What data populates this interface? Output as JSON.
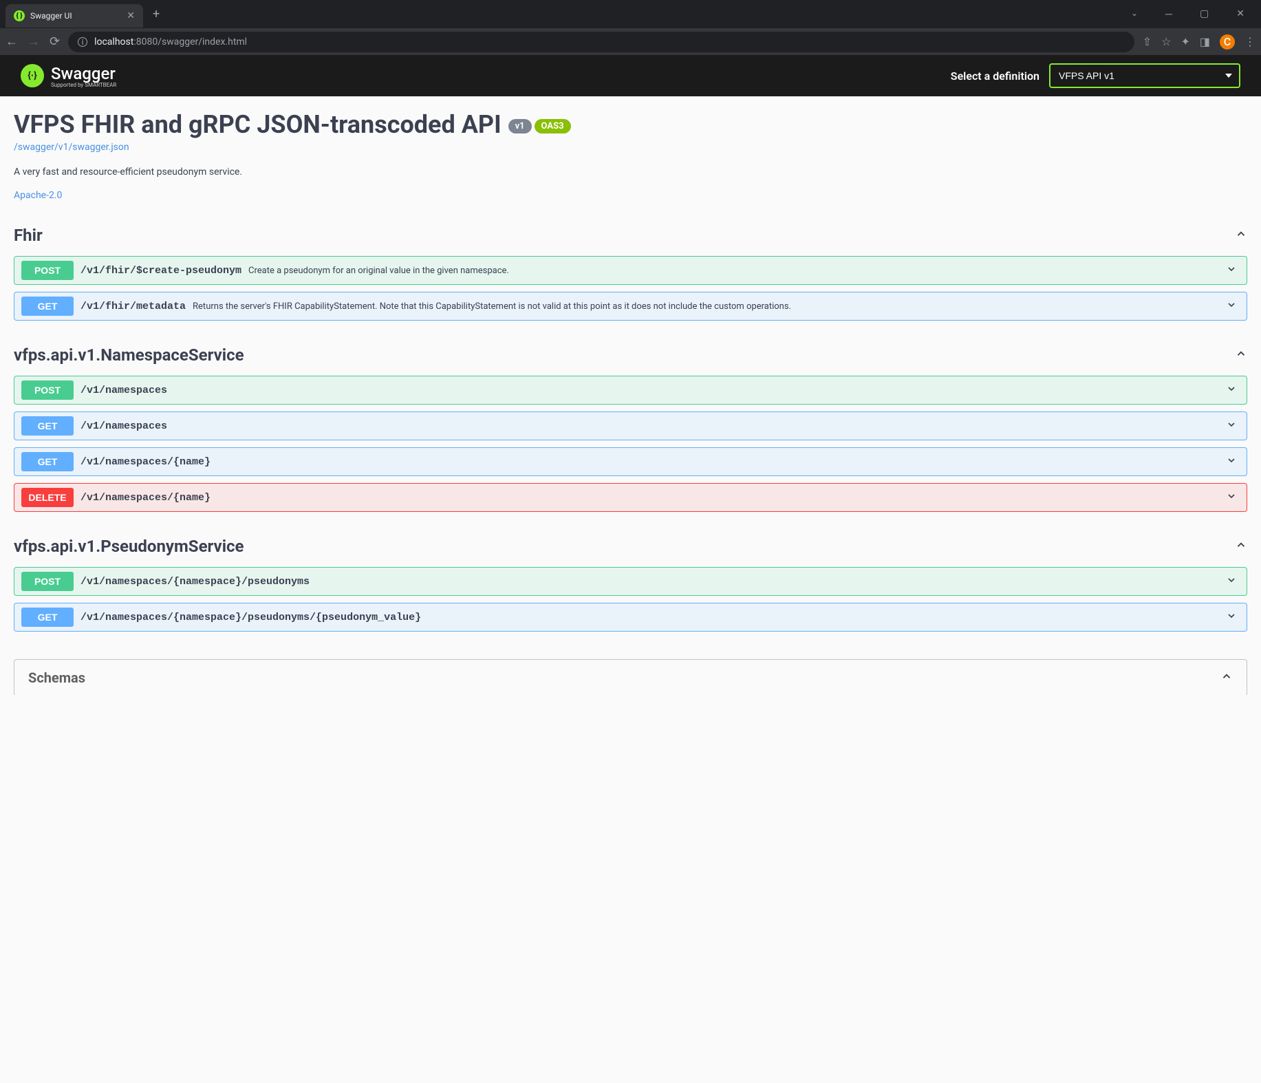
{
  "browser": {
    "tab_title": "Swagger UI",
    "url_host": "localhost",
    "url_port": ":8080",
    "url_path": "/swagger/index.html",
    "avatar_letter": "C"
  },
  "header": {
    "logo_text": "Swagger",
    "logo_subtitle": "Supported by SMARTBEAR",
    "select_label": "Select a definition",
    "selected_definition": "VFPS API v1"
  },
  "api": {
    "title": "VFPS FHIR and gRPC JSON-transcoded API",
    "version": "v1",
    "oas": "OAS3",
    "spec_url": "/swagger/v1/swagger.json",
    "description": "A very fast and resource-efficient pseudonym service.",
    "license": "Apache-2.0"
  },
  "tags": [
    {
      "name": "Fhir",
      "operations": [
        {
          "method": "POST",
          "cls": "op-post",
          "path": "/v1/fhir/$create-pseudonym",
          "desc": "Create a pseudonym for an original value in the given namespace."
        },
        {
          "method": "GET",
          "cls": "op-get",
          "path": "/v1/fhir/metadata",
          "desc": "Returns the server's FHIR CapabilityStatement. Note that this CapabilityStatement is not valid at this point as it does not include the custom operations."
        }
      ]
    },
    {
      "name": "vfps.api.v1.NamespaceService",
      "operations": [
        {
          "method": "POST",
          "cls": "op-post",
          "path": "/v1/namespaces",
          "desc": ""
        },
        {
          "method": "GET",
          "cls": "op-get",
          "path": "/v1/namespaces",
          "desc": ""
        },
        {
          "method": "GET",
          "cls": "op-get",
          "path": "/v1/namespaces/{name}",
          "desc": ""
        },
        {
          "method": "DELETE",
          "cls": "op-delete",
          "path": "/v1/namespaces/{name}",
          "desc": ""
        }
      ]
    },
    {
      "name": "vfps.api.v1.PseudonymService",
      "operations": [
        {
          "method": "POST",
          "cls": "op-post",
          "path": "/v1/namespaces/{namespace}/pseudonyms",
          "desc": ""
        },
        {
          "method": "GET",
          "cls": "op-get",
          "path": "/v1/namespaces/{namespace}/pseudonyms/{pseudonym_value}",
          "desc": ""
        }
      ]
    }
  ],
  "schemas": {
    "title": "Schemas"
  }
}
